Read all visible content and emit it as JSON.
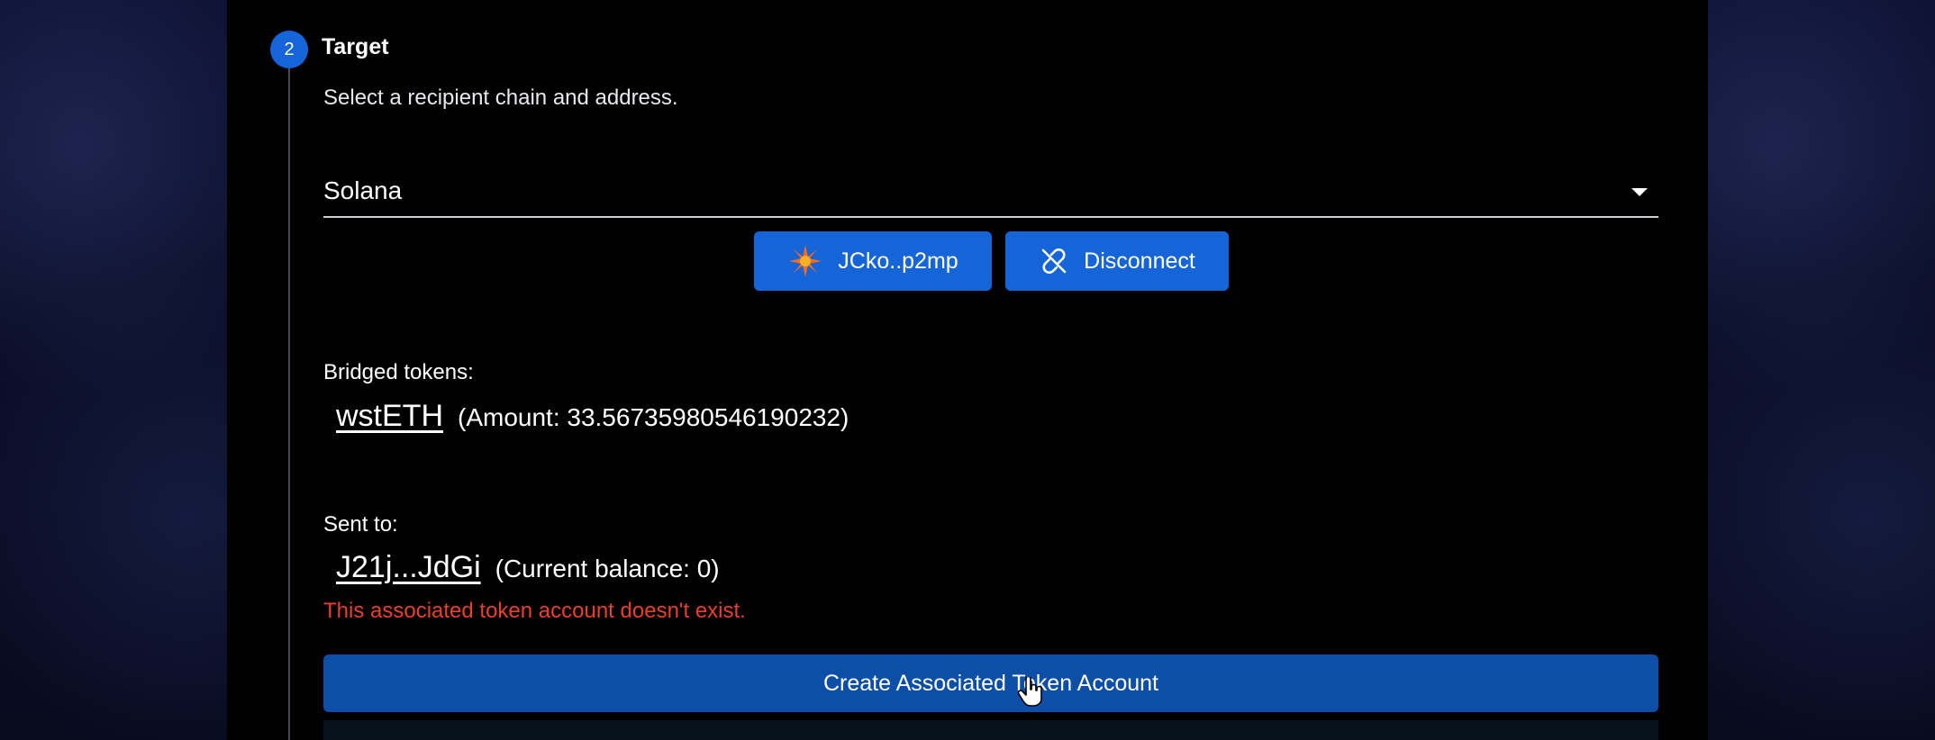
{
  "step": {
    "number": "2",
    "title": "Target",
    "description": "Select a recipient chain and address."
  },
  "chain_select": {
    "value": "Solana",
    "caret_icon": "caret-down-icon"
  },
  "wallet": {
    "address_label": "JCko..p2mp",
    "icon": "wallet-logo-icon",
    "disconnect_label": "Disconnect",
    "disconnect_icon": "unlink-icon"
  },
  "bridged": {
    "heading": "Bridged tokens:",
    "token": "wstETH",
    "amount_text": "(Amount: 33.56735980546190232)"
  },
  "sent_to": {
    "heading": "Sent to:",
    "address": "J21j...JdGi",
    "balance_text": "(Current balance: 0)",
    "error": "This associated token account doesn't exist."
  },
  "actions": {
    "create_label": "Create Associated Token Account"
  },
  "colors": {
    "accent": "#1565d8",
    "create_button": "#0d4fa6",
    "error": "#e8402e",
    "panel": "#000000"
  }
}
